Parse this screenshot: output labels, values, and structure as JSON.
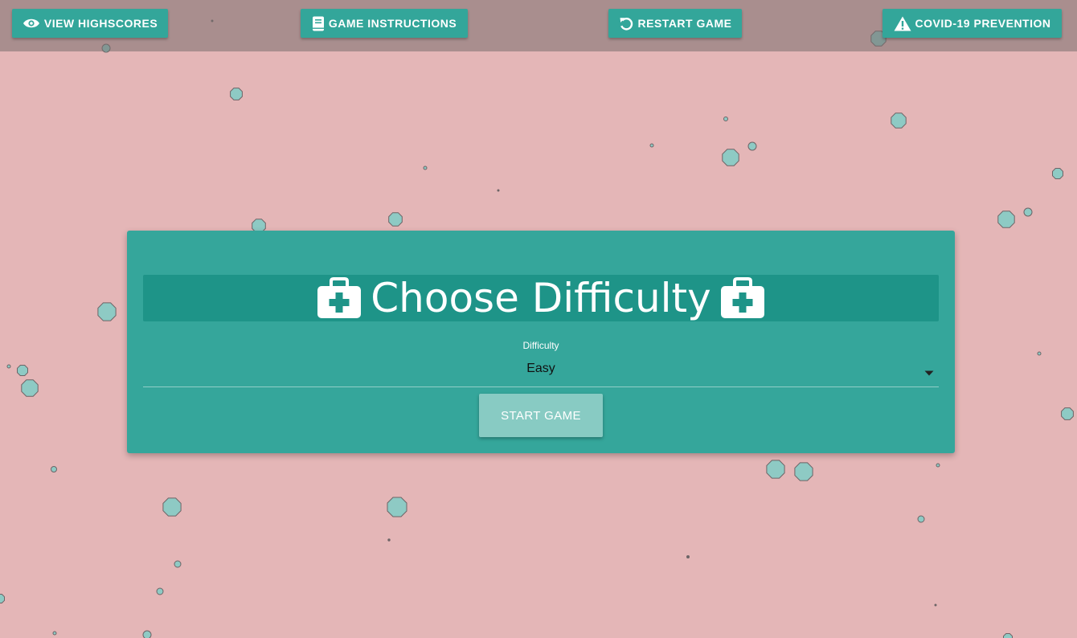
{
  "toolbar": {
    "highscores_label": "VIEW HIGHSCORES",
    "instructions_label": "GAME INSTRUCTIONS",
    "restart_label": "RESTART GAME",
    "covid_label": "COVID-19 PREVENTION"
  },
  "dialog": {
    "title": "Choose Difficulty",
    "select_label": "Difficulty",
    "select_value": "Easy",
    "start_label": "START GAME"
  },
  "colors": {
    "background": "#e4b6b7",
    "accent": "#33a69a",
    "title_band": "#1e9488",
    "start_button": "#88cbc3",
    "virus_fill": "#8ecac4"
  },
  "icons": {
    "highscores": "eye-icon",
    "instructions": "book-icon",
    "restart": "restart-icon",
    "covid": "warning-icon",
    "title": "medkit-icon",
    "select": "caret-down-icon"
  }
}
